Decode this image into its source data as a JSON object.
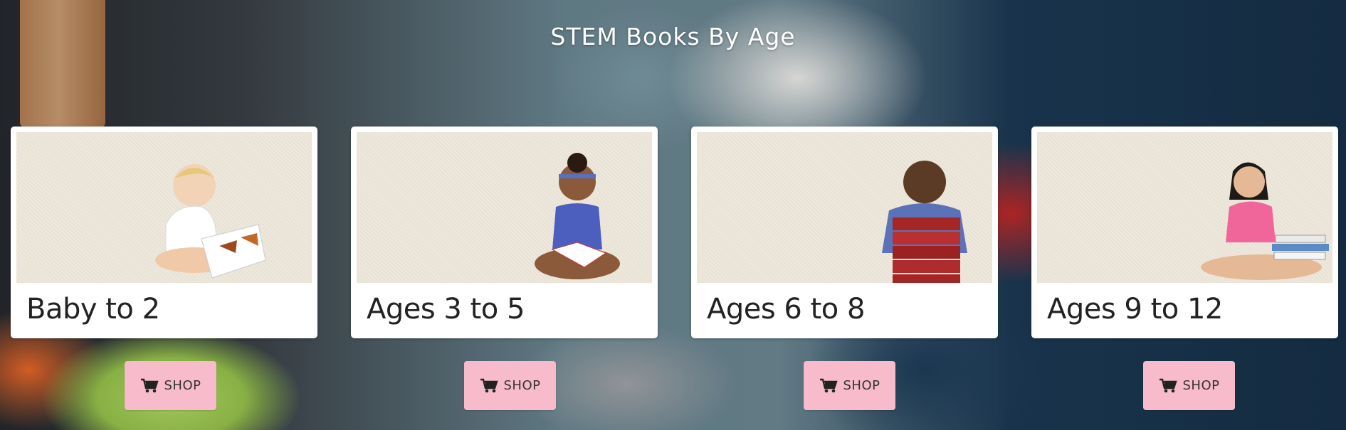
{
  "page": {
    "title": "STEM Books By Age"
  },
  "cards": [
    {
      "label": "Baby to 2",
      "button_label": "SHOP",
      "icon": "cart-icon"
    },
    {
      "label": "Ages 3 to 5",
      "button_label": "SHOP",
      "icon": "cart-icon"
    },
    {
      "label": "Ages 6 to 8",
      "button_label": "SHOP",
      "icon": "cart-icon"
    },
    {
      "label": "Ages 9 to 12",
      "button_label": "SHOP",
      "icon": "cart-icon"
    }
  ],
  "colors": {
    "button_bg": "#f8bbcb",
    "card_bg": "#ffffff",
    "photo_bg": "#ede6da"
  }
}
